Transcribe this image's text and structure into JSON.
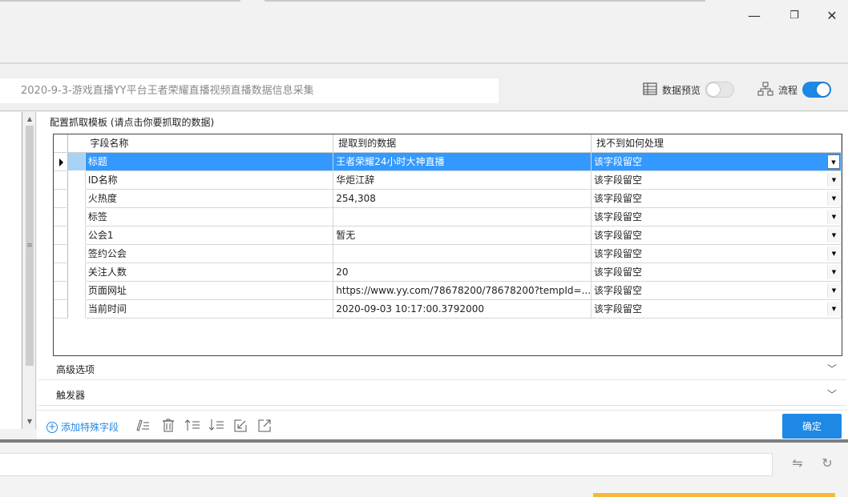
{
  "window": {
    "minimize_glyph": "—",
    "maximize_glyph": "❐",
    "close_glyph": "✕"
  },
  "header": {
    "task_name": "2020-9-3-游戏直播YY平台王者荣耀直播视频直播数据信息采集",
    "data_preview_label": "数据预览",
    "data_preview_on": false,
    "flow_label": "流程",
    "flow_on": true,
    "accent_color": "#1e88e5"
  },
  "panel": {
    "title": "配置抓取模板 (请点击你要抓取的数据)"
  },
  "grid": {
    "columns": [
      "字段名称",
      "提取到的数据",
      "找不到如何处理"
    ],
    "rows": [
      {
        "field": "标题",
        "value": "王者荣耀24小时大神直播",
        "handling": "该字段留空",
        "selected": true
      },
      {
        "field": "ID名称",
        "value": "华炬江辞",
        "handling": "该字段留空"
      },
      {
        "field": "火热度",
        "value": "254,308",
        "handling": "该字段留空"
      },
      {
        "field": "标签",
        "value": "",
        "handling": "该字段留空"
      },
      {
        "field": "公会1",
        "value": "暂无",
        "handling": "该字段留空"
      },
      {
        "field": "签约公会",
        "value": "",
        "handling": "该字段留空"
      },
      {
        "field": "关注人数",
        "value": "20",
        "handling": "该字段留空"
      },
      {
        "field": "页面网址",
        "value": "https://www.yy.com/78678200/78678200?tempId=...",
        "handling": "该字段留空"
      },
      {
        "field": "当前时间",
        "value": "2020-09-03 10:17:00.3792000",
        "handling": "该字段留空"
      }
    ]
  },
  "sections": {
    "advanced": "高级选项",
    "trigger": "触发器"
  },
  "toolbar": {
    "add_special_field": "添加特殊字段",
    "confirm": "确定"
  }
}
